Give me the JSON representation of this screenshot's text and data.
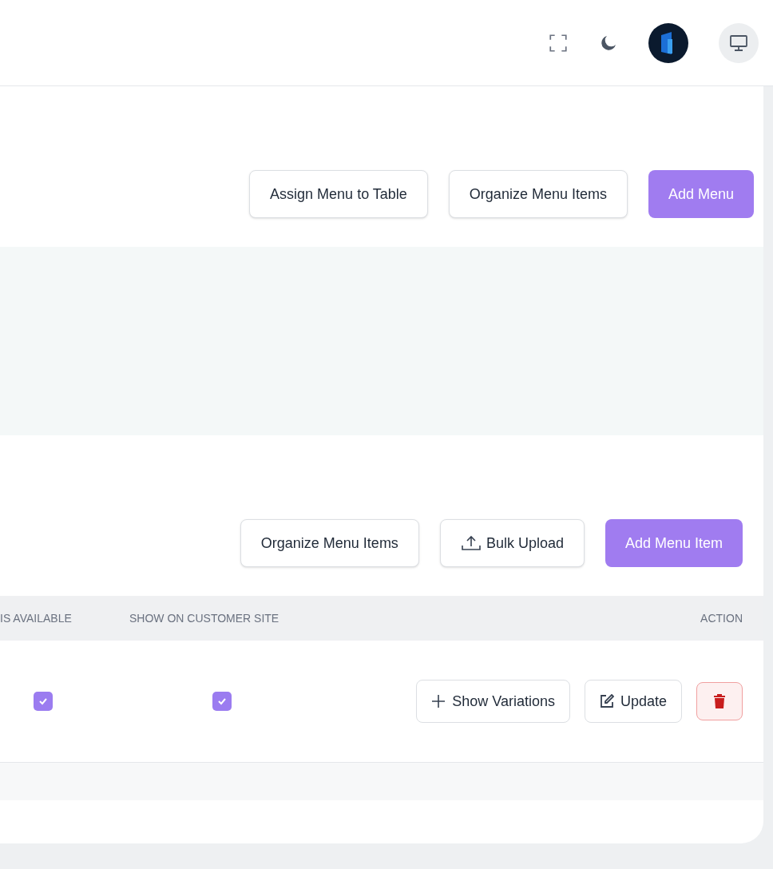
{
  "header": {
    "icons": [
      {
        "kind": "fullscreen"
      },
      {
        "kind": "theme"
      },
      {
        "kind": "avatar"
      },
      {
        "kind": "monitor"
      }
    ]
  },
  "menu_actions": [
    {
      "label": "Assign Menu to Table",
      "kind": "outline"
    },
    {
      "label": "Organize Menu Items",
      "kind": "outline"
    },
    {
      "label": "Add Menu",
      "kind": "primary"
    }
  ],
  "item_actions": [
    {
      "label": "Organize Menu Items",
      "kind": "outline"
    },
    {
      "label": "Bulk Upload",
      "kind": "upload"
    },
    {
      "label": "Add Menu Item",
      "kind": "primary"
    }
  ],
  "table": {
    "columns": [
      "IS AVAILABLE",
      "SHOW ON CUSTOMER SITE",
      "ACTION"
    ],
    "rows": [
      {
        "is_available": true,
        "show_on_customer_site": true,
        "actions": [
          {
            "label": "Show Variations",
            "kind": "plus"
          },
          {
            "label": "Update",
            "kind": "edit"
          },
          {
            "kind": "delete"
          }
        ]
      }
    ]
  }
}
